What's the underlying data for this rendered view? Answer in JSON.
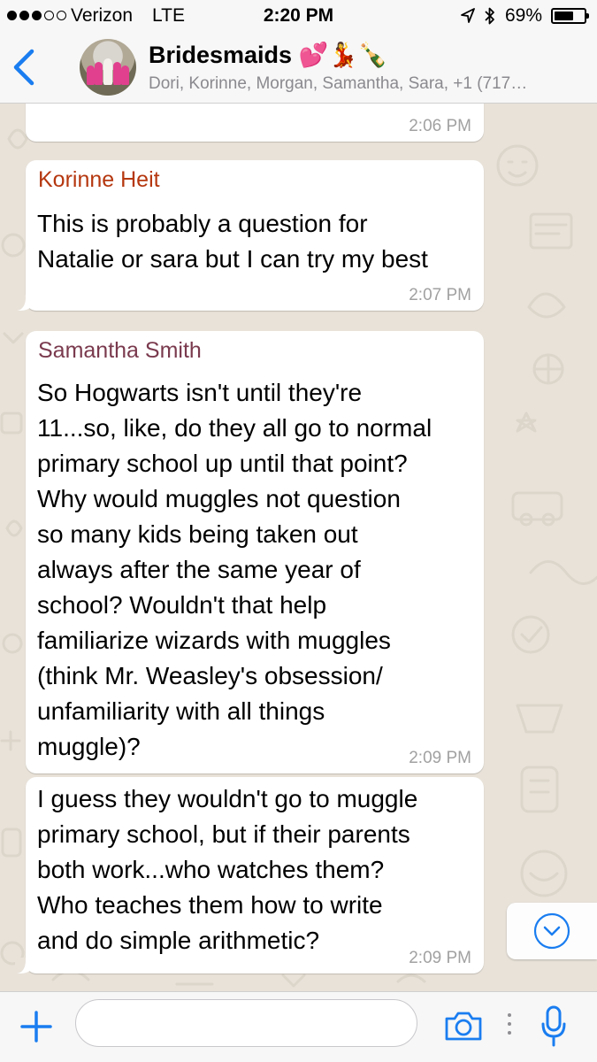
{
  "status_bar": {
    "carrier": "Verizon",
    "network": "LTE",
    "time": "2:20 PM",
    "battery_percent": "69%",
    "battery_level": 0.69,
    "signal_bars_filled": 3,
    "signal_bars_total": 5
  },
  "header": {
    "title": "Bridesmaids 💕💃🍾",
    "members": "Dori, Korinne, Morgan, Samantha, Sara, +1 (717…"
  },
  "messages": [
    {
      "sender": "",
      "text": "",
      "time": "2:06 PM"
    },
    {
      "sender": "Korinne Heit",
      "sender_color": "#b5370f",
      "lines": [
        "This is probably a question for",
        "Natalie or sara but I can try my best"
      ],
      "time": "2:07 PM"
    },
    {
      "sender": "Samantha Smith",
      "sender_color": "#7a3a4e",
      "lines": [
        "So Hogwarts isn't until they're",
        "11...so, like, do they all go to normal",
        "primary school up until that point?",
        "Why would muggles not question",
        "so many kids being taken out",
        "always after the same year of",
        "school? Wouldn't that help",
        "familiarize wizards with muggles",
        "(think Mr. Weasley's obsession/",
        "unfamiliarity with all things",
        "muggle)?"
      ],
      "time": "2:09 PM"
    },
    {
      "sender": "",
      "lines": [
        "I guess they wouldn't go to muggle",
        "primary school, but if their parents",
        "both work...who watches them?",
        "Who teaches them how to write",
        "and do simple arithmetic?"
      ],
      "time": "2:09 PM"
    }
  ],
  "input": {
    "placeholder": "",
    "value": ""
  },
  "colors": {
    "accent": "#1a7df0",
    "chat_background": "#e8e2d9",
    "bubble": "#ffffff",
    "timestamp": "#a1a1a1"
  },
  "icons": {
    "back": "chevron-left-icon",
    "add": "plus-icon",
    "camera": "camera-icon",
    "more": "more-vertical-icon",
    "mic": "microphone-icon",
    "scroll": "chevron-down-circle-icon",
    "location": "location-arrow-icon",
    "bluetooth": "bluetooth-icon"
  }
}
